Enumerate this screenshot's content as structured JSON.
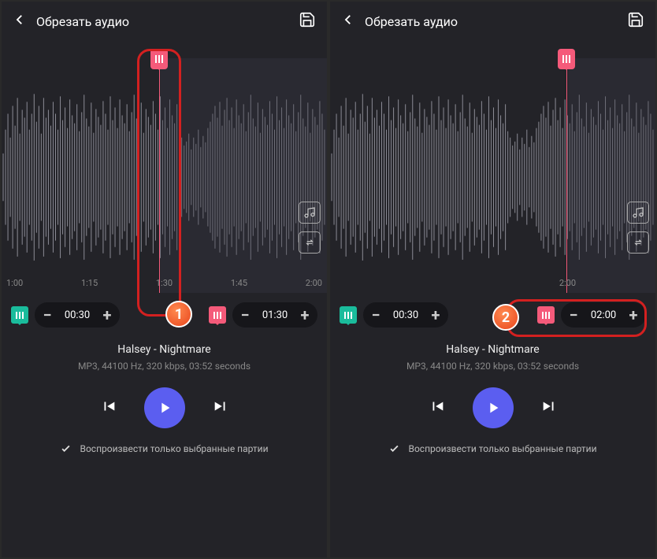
{
  "header": {
    "title": "Обрезать аудио"
  },
  "timeline": {
    "t0": "1:00",
    "t1": "1:15",
    "t2": "1:30",
    "t3": "1:45",
    "t4": "2:00"
  },
  "trim": {
    "start": "00:30",
    "end_left": "01:30",
    "end_right": "02:00"
  },
  "track": {
    "name": "Halsey - Nightmare",
    "meta": "MP3, 44100 Hz, 320 kbps, 03:52 seconds"
  },
  "checkbox_label": "Воспроизвести только выбранные партии",
  "badges": {
    "b1": "1",
    "b2": "2"
  }
}
